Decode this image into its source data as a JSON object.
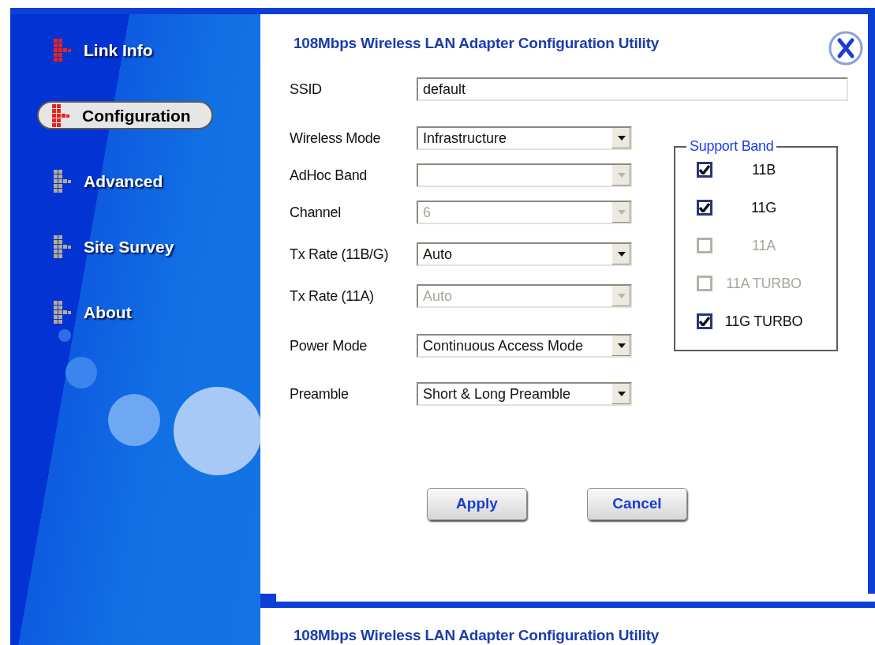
{
  "sidebar": {
    "items": [
      {
        "label": "Link Info",
        "selected": false,
        "color": "#e8231a"
      },
      {
        "label": "Configuration",
        "selected": true,
        "color": "#e8231a"
      },
      {
        "label": "Advanced",
        "selected": false,
        "color": "#b4ac94"
      },
      {
        "label": "Site Survey",
        "selected": false,
        "color": "#b4ac94"
      },
      {
        "label": "About",
        "selected": false,
        "color": "#b4ac94"
      }
    ]
  },
  "window": {
    "title": "108Mbps Wireless LAN Adapter Configuration Utility"
  },
  "form": {
    "fields": [
      {
        "kind": "text",
        "label": "SSID",
        "value": "default",
        "disabled": false
      },
      {
        "kind": "select",
        "label": "Wireless Mode",
        "value": "Infrastructure",
        "disabled": false
      },
      {
        "kind": "select",
        "label": "AdHoc Band",
        "disabled": true
      },
      {
        "kind": "select",
        "label": "Channel",
        "value": "6",
        "disabled": true
      },
      {
        "kind": "select",
        "label": "Tx Rate (11B/G)",
        "value": "Auto",
        "disabled": false
      },
      {
        "kind": "select",
        "label": "Tx Rate (11A)",
        "value": "Auto",
        "disabled": true
      },
      {
        "kind": "select",
        "label": "Power Mode",
        "value": "Continuous Access Mode",
        "disabled": false
      },
      {
        "kind": "select",
        "label": "Preamble",
        "value": "Short & Long Preamble",
        "disabled": false
      }
    ]
  },
  "support_band": {
    "title": "Support Band",
    "options": [
      {
        "label": "11B",
        "checked": true,
        "disabled": false
      },
      {
        "label": "11G",
        "checked": true,
        "disabled": false
      },
      {
        "label": "11A",
        "checked": false,
        "disabled": true
      },
      {
        "label": "11A TURBO",
        "checked": false,
        "disabled": true
      },
      {
        "label": "11G TURBO",
        "checked": true,
        "disabled": false
      }
    ]
  },
  "buttons": [
    "Apply",
    "Cancel"
  ],
  "footer_title": "108Mbps Wireless LAN Adapter Configuration Utility"
}
